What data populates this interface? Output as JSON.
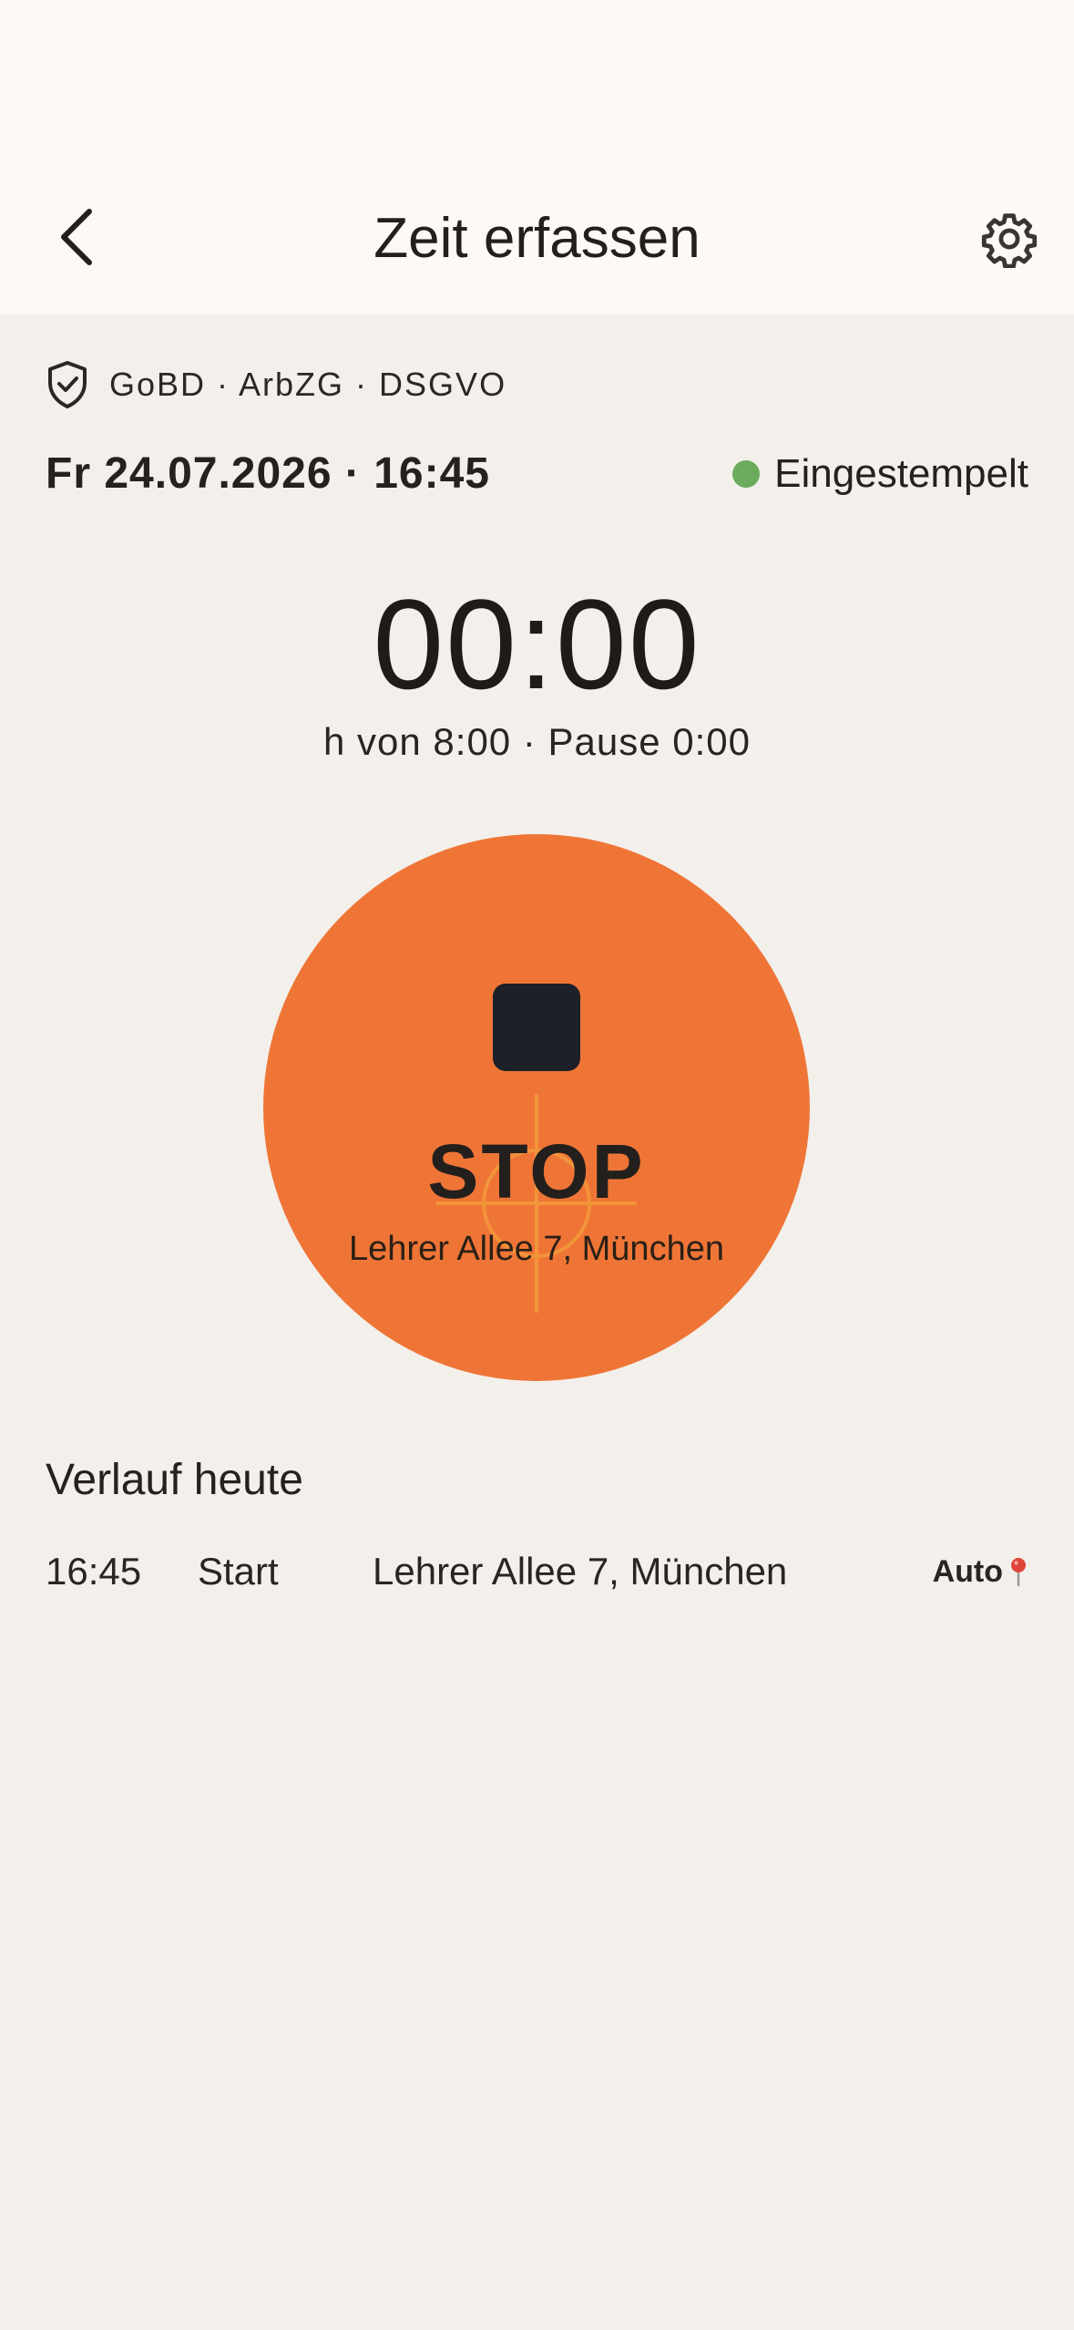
{
  "header": {
    "title": "Zeit erfassen",
    "back_icon": "chevron-left-icon",
    "settings_icon": "gear-icon"
  },
  "compliance": {
    "icon": "shield-check-icon",
    "text": "GoBD · ArbZG · DSGVO"
  },
  "datetime": "Fr 24.07.2026 · 16:45",
  "status": {
    "label": "Eingestempelt",
    "color": "#6aac5c"
  },
  "timer": {
    "value": "00:00",
    "subtitle": "h von 8:00 · Pause 0:00"
  },
  "stop_button": {
    "label": "STOP",
    "location": "Lehrer Allee 7, München",
    "color": "#ef7537",
    "icon": "stop-square-icon"
  },
  "history": {
    "title": "Verlauf heute",
    "entries": [
      {
        "time": "16:45",
        "type": "Start",
        "location": "Lehrer Allee 7, München",
        "source": "Auto",
        "source_icon": "map-pin-icon"
      }
    ]
  }
}
